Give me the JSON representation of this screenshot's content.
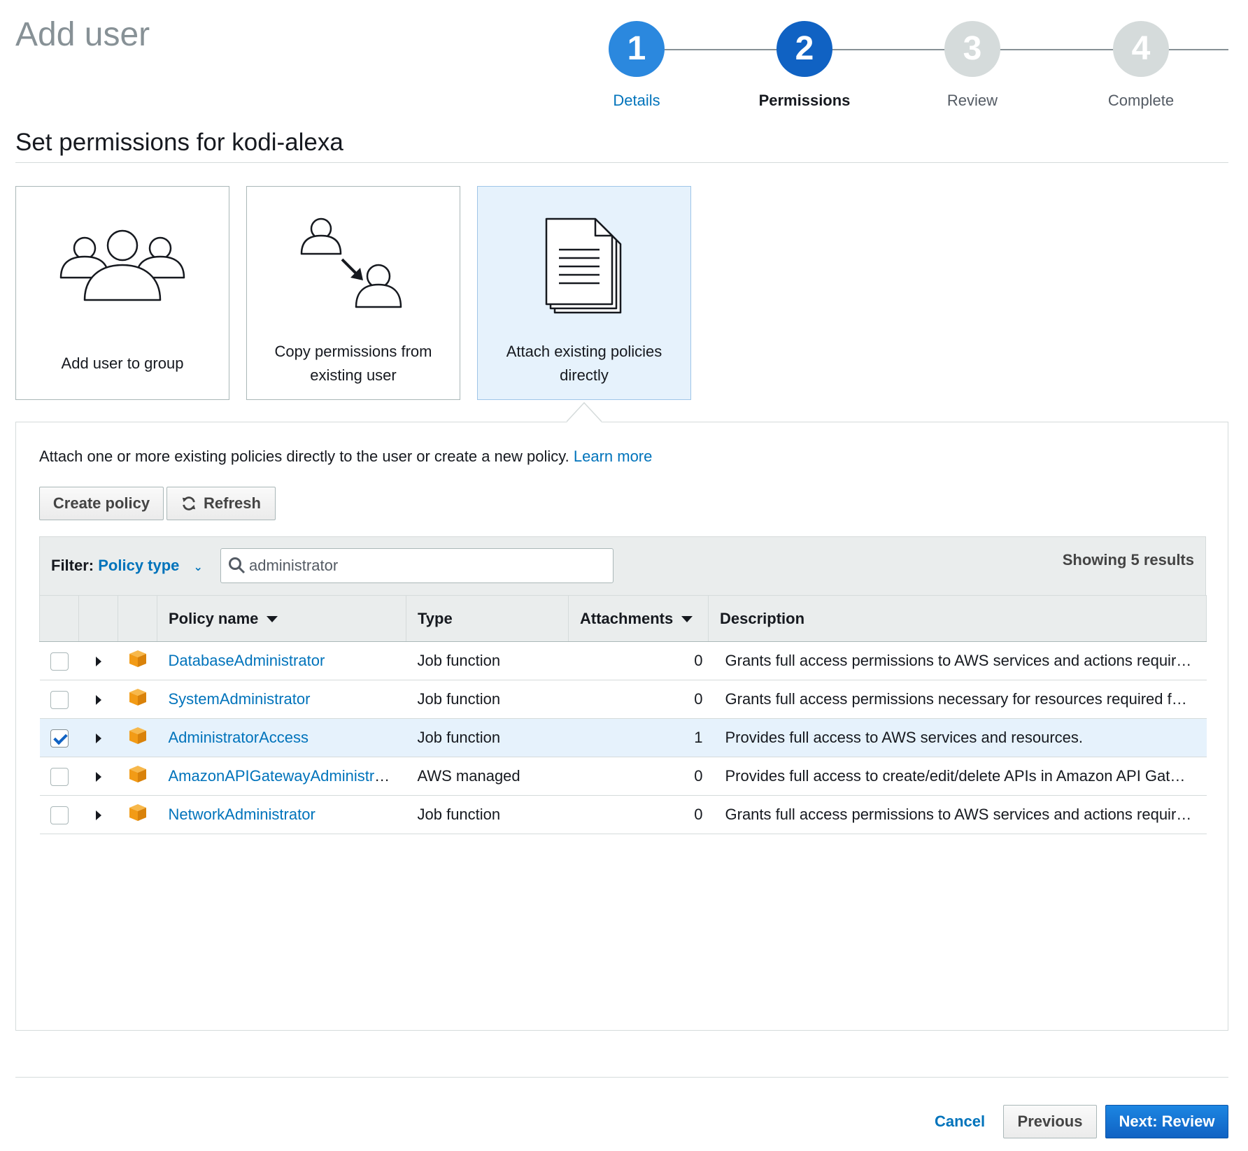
{
  "header": {
    "title": "Add user"
  },
  "wizard": {
    "steps": [
      {
        "number": "1",
        "label": "Details",
        "state": "done"
      },
      {
        "number": "2",
        "label": "Permissions",
        "state": "current"
      },
      {
        "number": "3",
        "label": "Review",
        "state": "todo"
      },
      {
        "number": "4",
        "label": "Complete",
        "state": "todo"
      }
    ],
    "colors": {
      "done": "#2b88de",
      "current": "#1062c3",
      "todo": "#d5dbdb"
    }
  },
  "permissions": {
    "title": "Set permissions for kodi-alexa",
    "options": [
      {
        "label": "Add user to group",
        "icon": "users-group-icon",
        "selected": false
      },
      {
        "label_line1": "Copy permissions from",
        "label_line2": "existing user",
        "icon": "copy-user-icon",
        "selected": false
      },
      {
        "label_line1": "Attach existing policies",
        "label_line2": "directly",
        "icon": "policy-document-icon",
        "selected": true
      }
    ]
  },
  "panel": {
    "intro": "Attach one or more existing policies directly to the user or create a new policy.",
    "learn_more": "Learn more",
    "create_policy": "Create policy",
    "refresh": "Refresh",
    "filter": {
      "label": "Filter:",
      "value": "Policy type",
      "search_value": "administrator",
      "results": "Showing 5 results"
    },
    "columns": {
      "policy_name": "Policy name",
      "type": "Type",
      "attachments": "Attachments",
      "description": "Description"
    },
    "rows": [
      {
        "name": "DatabaseAdministrator",
        "type": "Job function",
        "attachments": "0",
        "description": "Grants full access permissions to AWS services and actions requir…",
        "checked": false
      },
      {
        "name": "SystemAdministrator",
        "type": "Job function",
        "attachments": "0",
        "description": "Grants full access permissions necessary for resources required f…",
        "checked": false
      },
      {
        "name": "AdministratorAccess",
        "type": "Job function",
        "attachments": "1",
        "description": "Provides full access to AWS services and resources.",
        "checked": true
      },
      {
        "name": "AmazonAPIGatewayAdministrat…",
        "type": "AWS managed",
        "attachments": "0",
        "description": "Provides full access to create/edit/delete APIs in Amazon API Gat…",
        "checked": false
      },
      {
        "name": "NetworkAdministrator",
        "type": "Job function",
        "attachments": "0",
        "description": "Grants full access permissions to AWS services and actions requir…",
        "checked": false
      }
    ]
  },
  "footer": {
    "cancel": "Cancel",
    "previous": "Previous",
    "next": "Next: Review"
  },
  "colors": {
    "link": "#0073bb",
    "primary": "#1062c3",
    "selected_bg": "#e6f2fc",
    "policy_icon": "#f29b16"
  }
}
